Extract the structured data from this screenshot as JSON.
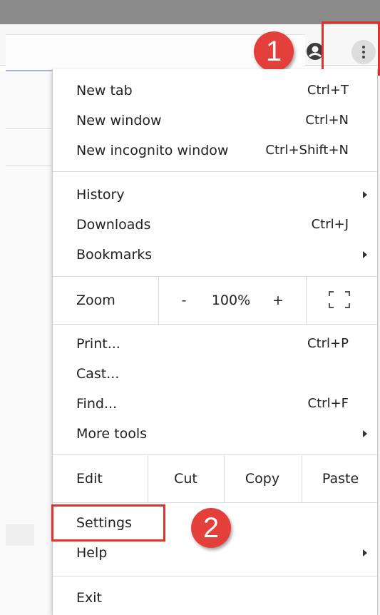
{
  "annotations": {
    "step1": "1",
    "step2": "2",
    "highlight_color": "#e0312f"
  },
  "toolbar": {
    "profile_icon": "account-circle-icon",
    "menu_icon": "vertical-dots-icon"
  },
  "menu": {
    "group1": [
      {
        "label": "New tab",
        "shortcut": "Ctrl+T"
      },
      {
        "label": "New window",
        "shortcut": "Ctrl+N"
      },
      {
        "label": "New incognito window",
        "shortcut": "Ctrl+Shift+N"
      }
    ],
    "group2": [
      {
        "label": "History",
        "shortcut": ""
      },
      {
        "label": "Downloads",
        "shortcut": "Ctrl+J"
      },
      {
        "label": "Bookmarks",
        "shortcut": ""
      }
    ],
    "zoom": {
      "label": "Zoom",
      "minus": "-",
      "value": "100%",
      "plus": "+",
      "fullscreen_icon": "fullscreen-icon"
    },
    "group3": [
      {
        "label": "Print...",
        "shortcut": "Ctrl+P"
      },
      {
        "label": "Cast...",
        "shortcut": ""
      },
      {
        "label": "Find...",
        "shortcut": "Ctrl+F"
      },
      {
        "label": "More tools",
        "shortcut": ""
      }
    ],
    "edit": {
      "label": "Edit",
      "cut": "Cut",
      "copy": "Copy",
      "paste": "Paste"
    },
    "group4": [
      {
        "label": "Settings"
      },
      {
        "label": "Help"
      }
    ],
    "exit": "Exit"
  }
}
